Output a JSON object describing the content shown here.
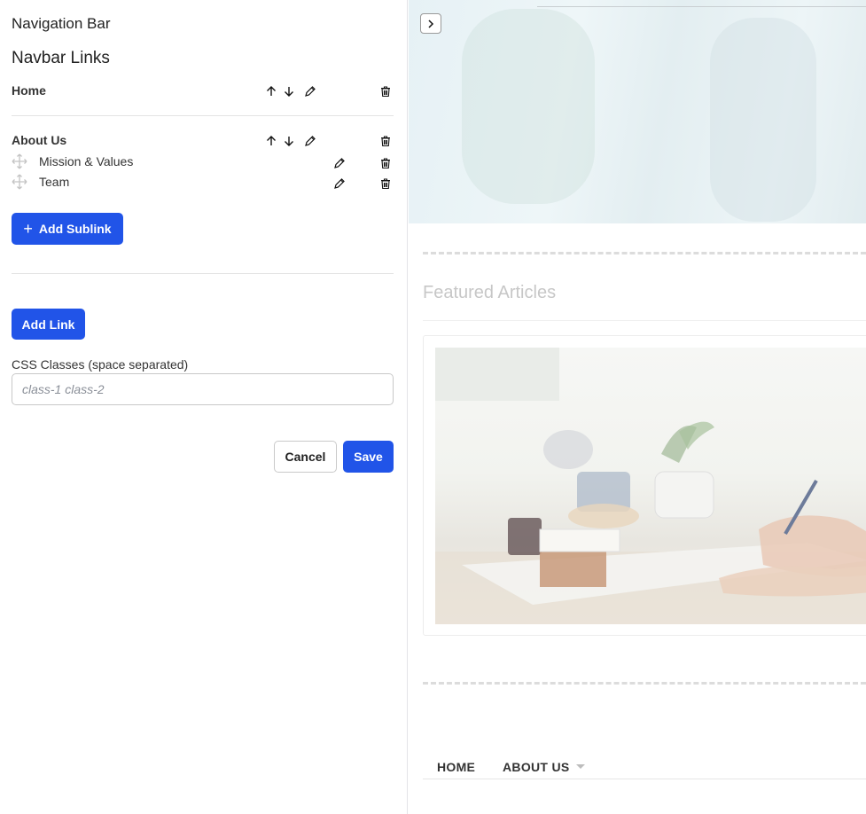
{
  "panel": {
    "title": "Navigation Bar",
    "section_title": "Navbar Links",
    "links": [
      {
        "label": "Home",
        "sublinks": []
      },
      {
        "label": "About Us",
        "sublinks": [
          {
            "label": "Mission & Values"
          },
          {
            "label": "Team"
          }
        ]
      }
    ],
    "add_sublink_label": "Add Sublink",
    "add_link_label": "Add Link",
    "css_field": {
      "label": "CSS Classes (space separated)",
      "placeholder": "class-1 class-2",
      "value": ""
    },
    "cancel_label": "Cancel",
    "save_label": "Save"
  },
  "preview": {
    "featured_title": "Featured Articles",
    "nav": [
      {
        "label": "HOME"
      },
      {
        "label": "ABOUT US"
      }
    ]
  },
  "icons": {
    "move_up": "arrow-up-icon",
    "move_down": "arrow-down-icon",
    "edit": "pencil-icon",
    "delete": "trash-icon",
    "drag": "move-handle-icon",
    "expand": "chevron-right-icon",
    "add": "plus-icon",
    "dropdown": "caret-down-icon"
  },
  "colors": {
    "primary": "#2154e8",
    "border": "#c8c8c8",
    "muted_text": "#c7c7c7"
  }
}
